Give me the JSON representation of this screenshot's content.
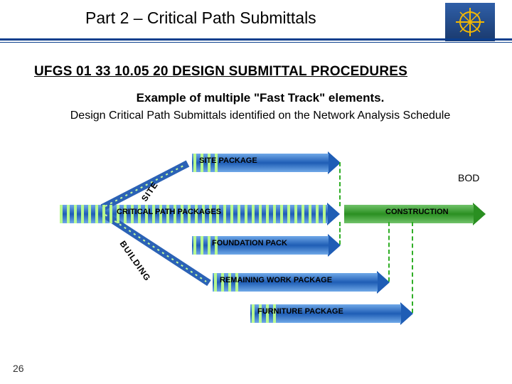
{
  "header": {
    "title": "Part 2 – Critical Path Submittals"
  },
  "section": {
    "title": "UFGS 01 33 10.05 20  DESIGN SUBMITTAL PROCEDURES",
    "example": "Example of multiple \"Fast Track\" elements.",
    "subline": "Design Critical Path Submittals identified on the Network Analysis Schedule"
  },
  "labels": {
    "site_slope": "SITE",
    "building_slope": "BUILDING",
    "site_package": "SITE PACKAGE",
    "critical_path_packages": "CRITICAL PATH PACKAGES",
    "foundation_pack": "FOUNDATION PACK",
    "remaining_work_package": "REMAINING WORK PACKAGE",
    "furniture_package": "FURNITURE PACKAGE",
    "construction": "CONSTRUCTION",
    "bod": "BOD"
  },
  "page_number": "26"
}
